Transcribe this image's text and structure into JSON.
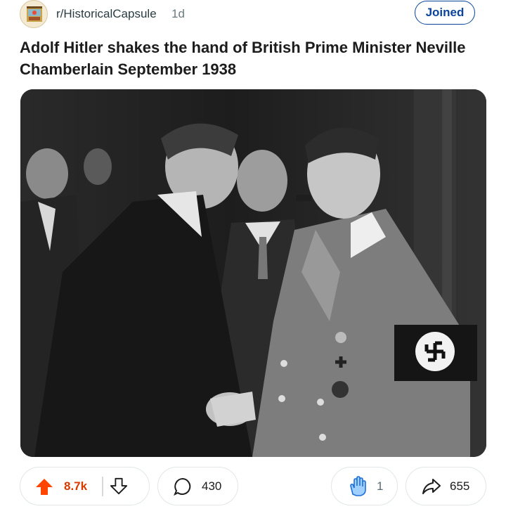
{
  "post": {
    "subreddit": "r/HistoricalCapsule",
    "age": "1d",
    "joined_label": "Joined",
    "title": "Adolf Hitler shakes the hand of British Prime Minister Neville Chamberlain September 1938"
  },
  "actions": {
    "upvotes": "8.7k",
    "comments": "430",
    "awards": "1",
    "shares": "655"
  },
  "colors": {
    "upvote_active": "#ff4500",
    "upvote_count": "#d93a00",
    "joined_border": "#0a449b",
    "award_icon": "#3aa0ff"
  },
  "icons": [
    "subreddit-avatar-icon",
    "upvote-arrow-icon",
    "downvote-arrow-icon",
    "comment-bubble-icon",
    "award-hands-icon",
    "share-arrow-icon"
  ]
}
